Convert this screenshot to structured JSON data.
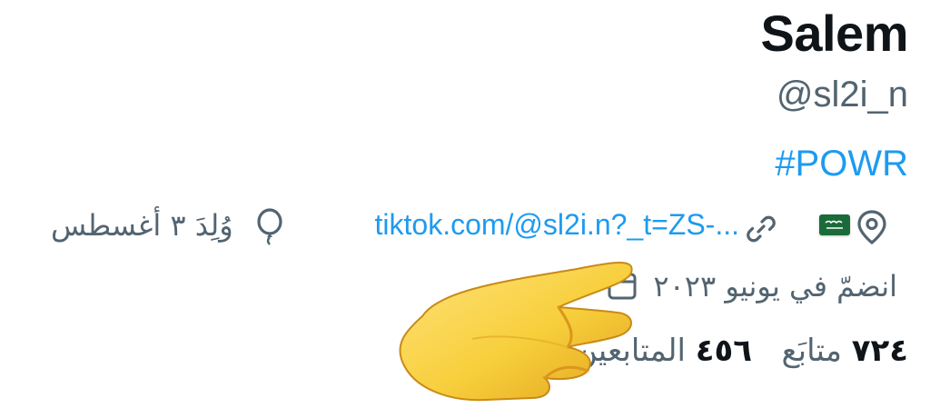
{
  "profile": {
    "name": "Salem",
    "handle": "@sl2i_n",
    "bio_hashtag": "#POWR",
    "location_flag": "saudi-arabia-flag",
    "website": "tiktok.com/@sl2i.n?_t=ZS-...",
    "birthday": "وُلِدَ ٣ أغسطس",
    "joined": "انضمّ في يونيو ٢٠٢٣"
  },
  "stats": {
    "following_count": "٧٢٤",
    "following_label": "متابَع",
    "followers_count": "٤٥٦",
    "followers_label": "المتابعين"
  },
  "colors": {
    "link": "#1d9bf0",
    "secondary_text": "#536471",
    "primary_text": "#0f1419",
    "flag_green": "#1b6b3a",
    "hand_emoji": "#f7cf3c"
  },
  "overlay": {
    "emoji": "pointing-hand-emoji"
  }
}
